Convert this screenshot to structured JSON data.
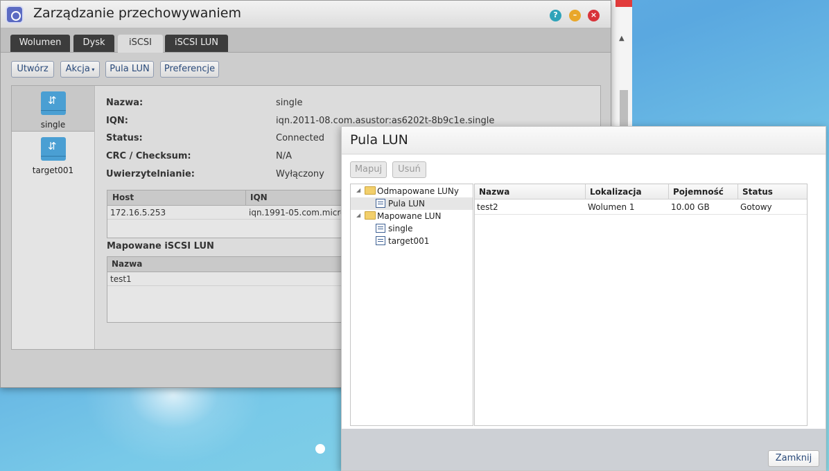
{
  "main_window": {
    "title": "Zarządzanie przechowywaniem",
    "tabs": [
      "Wolumen",
      "Dysk",
      "iSCSI",
      "iSCSI LUN"
    ],
    "active_tab": "iSCSI",
    "toolbar": {
      "create": "Utwórz",
      "action": "Akcja",
      "lun_pool": "Pula LUN",
      "preferences": "Preferencje"
    },
    "targets": [
      "single",
      "target001"
    ],
    "selected_target": "single",
    "details": {
      "name_label": "Nazwa:",
      "name_value": "single",
      "iqn_label": "IQN:",
      "iqn_value": "iqn.2011-08.com.asustor:as6202t-8b9c1e.single",
      "status_label": "Status:",
      "status_value": "Connected",
      "crc_label": "CRC / Checksum:",
      "crc_value": "N/A",
      "auth_label": "Uwierzytelnianie:",
      "auth_value": "Wyłączony"
    },
    "hosts_table": {
      "columns": [
        "Host",
        "IQN"
      ],
      "rows": [
        [
          "172.16.5.253",
          "iqn.1991-05.com.micros"
        ]
      ]
    },
    "mapped_title": "Mapowane iSCSI LUN",
    "mapped_table": {
      "columns": [
        "Nazwa"
      ],
      "rows": [
        [
          "test1"
        ]
      ]
    }
  },
  "dialog": {
    "title": "Pula LUN",
    "map_button": "Mapuj",
    "delete_button": "Usuń",
    "tree": {
      "unmapped": "Odmapowane LUNy",
      "lun_pool": "Pula LUN",
      "mapped": "Mapowane LUN",
      "mapped_children": [
        "single",
        "target001"
      ]
    },
    "table": {
      "columns": [
        "Nazwa",
        "Lokalizacja",
        "Pojemność",
        "Status"
      ],
      "rows": [
        [
          "test2",
          "Wolumen 1",
          "10.00 GB",
          "Gotowy"
        ]
      ]
    },
    "close_button": "Zamknij"
  },
  "icons": {
    "app": "storage-manager-icon",
    "help": "help-icon",
    "minimize": "minimize-icon",
    "close": "close-icon",
    "target": "iscsi-target-icon",
    "folder": "folder-icon",
    "lun": "lun-icon"
  },
  "colors": {
    "help": "#2fa3b9",
    "minimize": "#e9a72a",
    "close": "#d8333a",
    "target_icon": "#4a9fd3"
  }
}
